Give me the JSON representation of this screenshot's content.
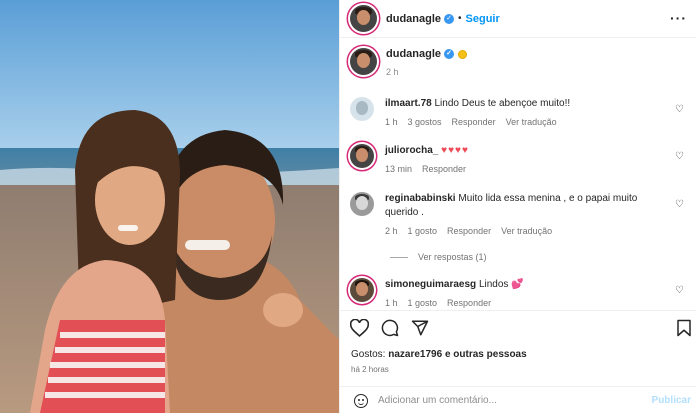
{
  "header": {
    "username": "dudanagle",
    "separator": "•",
    "follow_label": "Seguir",
    "more_label": "···"
  },
  "caption": {
    "username": "dudanagle",
    "time": "2 h"
  },
  "comments": [
    {
      "username": "ilmaart.78",
      "text": "Lindo Deus te abençoe muito!!",
      "time": "1 h",
      "likes": "3 gostos",
      "reply": "Responder",
      "translate": "Ver tradução"
    },
    {
      "username": "juliorocha_",
      "text": "",
      "hearts": "♥♥♥♥",
      "time": "13 min",
      "reply": "Responder"
    },
    {
      "username": "reginababinski",
      "text": "Muito lida essa menina , e o papai muito querido .",
      "time": "2 h",
      "likes": "1 gosto",
      "reply": "Responder",
      "translate": "Ver tradução"
    },
    {
      "username": "simoneguimaraesg",
      "text": "Lindos",
      "emoji": "💕",
      "time": "1 h",
      "likes": "1 gosto",
      "reply": "Responder"
    }
  ],
  "view_replies": "Ver respostas (1)",
  "likes_line": {
    "prefix": "Gostos: ",
    "user": "nazare1796",
    "suffix": " e outras pessoas"
  },
  "posted_ago": "há 2 horas",
  "comment_box": {
    "placeholder": "Adicionar um comentário...",
    "post_label": "Publicar"
  },
  "colors": {
    "accent": "#0095f6",
    "verified": "#3897f0",
    "heart_red": "#ed4956"
  },
  "icons": [
    "verified-icon",
    "heart-icon",
    "comment-icon",
    "share-icon",
    "save-icon",
    "emoji-icon"
  ]
}
